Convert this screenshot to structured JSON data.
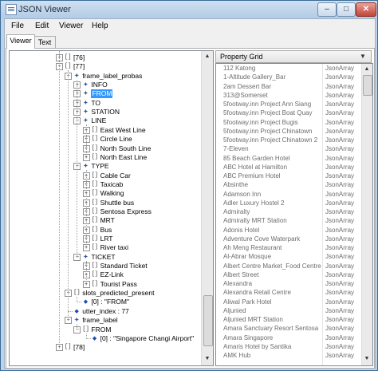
{
  "window": {
    "title": "JSON Viewer"
  },
  "menu": [
    "File",
    "Edit",
    "Viewer",
    "Help"
  ],
  "tabs": [
    {
      "label": "Viewer",
      "active": true
    },
    {
      "label": "Text",
      "active": false
    }
  ],
  "tree": [
    {
      "depth": 0,
      "icon": "array",
      "label": "[76]",
      "exp": "+"
    },
    {
      "depth": 0,
      "icon": "array",
      "label": "[77]",
      "exp": "-"
    },
    {
      "depth": 1,
      "icon": "object",
      "label": "frame_label_probas",
      "exp": "-"
    },
    {
      "depth": 2,
      "icon": "object",
      "label": "INFO",
      "exp": "+"
    },
    {
      "depth": 2,
      "icon": "object",
      "label": "FROM",
      "exp": "+",
      "selected": true
    },
    {
      "depth": 2,
      "icon": "object",
      "label": "TO",
      "exp": "+"
    },
    {
      "depth": 2,
      "icon": "object",
      "label": "STATION",
      "exp": "+"
    },
    {
      "depth": 2,
      "icon": "object",
      "label": "LINE",
      "exp": "-"
    },
    {
      "depth": 3,
      "icon": "array",
      "label": "East West Line",
      "exp": "+"
    },
    {
      "depth": 3,
      "icon": "array",
      "label": "Circle Line",
      "exp": "+"
    },
    {
      "depth": 3,
      "icon": "array",
      "label": "North South Line",
      "exp": "+"
    },
    {
      "depth": 3,
      "icon": "array",
      "label": "North East Line",
      "exp": "+"
    },
    {
      "depth": 2,
      "icon": "object",
      "label": "TYPE",
      "exp": "-"
    },
    {
      "depth": 3,
      "icon": "array",
      "label": "Cable Car",
      "exp": "+"
    },
    {
      "depth": 3,
      "icon": "array",
      "label": "Taxicab",
      "exp": "+"
    },
    {
      "depth": 3,
      "icon": "array",
      "label": "Walking",
      "exp": "+"
    },
    {
      "depth": 3,
      "icon": "array",
      "label": "Shuttle bus",
      "exp": "+"
    },
    {
      "depth": 3,
      "icon": "array",
      "label": "Sentosa Express",
      "exp": "+"
    },
    {
      "depth": 3,
      "icon": "array",
      "label": "MRT",
      "exp": "+"
    },
    {
      "depth": 3,
      "icon": "array",
      "label": "Bus",
      "exp": "+"
    },
    {
      "depth": 3,
      "icon": "array",
      "label": "LRT",
      "exp": "+"
    },
    {
      "depth": 3,
      "icon": "array",
      "label": "River taxi",
      "exp": "+"
    },
    {
      "depth": 2,
      "icon": "object",
      "label": "TICKET",
      "exp": "-"
    },
    {
      "depth": 3,
      "icon": "array",
      "label": "Standard Ticket",
      "exp": "+"
    },
    {
      "depth": 3,
      "icon": "array",
      "label": "EZ-Link",
      "exp": "+"
    },
    {
      "depth": 3,
      "icon": "array",
      "label": "Tourist Pass",
      "exp": "+"
    },
    {
      "depth": 1,
      "icon": "array",
      "label": "slots_predicted_present",
      "exp": "-"
    },
    {
      "depth": 2,
      "icon": "value",
      "label": "[0] : \"FROM\"",
      "exp": ""
    },
    {
      "depth": 1,
      "icon": "value",
      "label": "utter_index : 77",
      "exp": ""
    },
    {
      "depth": 1,
      "icon": "object",
      "label": "frame_label",
      "exp": "-"
    },
    {
      "depth": 2,
      "icon": "array",
      "label": "FROM",
      "exp": "-"
    },
    {
      "depth": 3,
      "icon": "value",
      "label": "[0] : \"Singapore Changi Airport\"",
      "exp": ""
    },
    {
      "depth": 0,
      "icon": "array",
      "label": "[78]",
      "exp": "+"
    }
  ],
  "property_grid": {
    "combo_label": "Property Grid",
    "rows": [
      [
        "112 Katong",
        "JsonArray"
      ],
      [
        "1-Altitude Gallery_Bar",
        "JsonArray"
      ],
      [
        "2am Dessert Bar",
        "JsonArray"
      ],
      [
        "313@Somerset",
        "JsonArray"
      ],
      [
        "5footway.inn Project Ann Siang",
        "JsonArray"
      ],
      [
        "5footway.inn Project Boat Quay",
        "JsonArray"
      ],
      [
        "5footway.inn Project Bugis",
        "JsonArray"
      ],
      [
        "5footway.inn Project Chinatown",
        "JsonArray"
      ],
      [
        "5footway.inn Project Chinatown 2",
        "JsonArray"
      ],
      [
        "7-Eleven",
        "JsonArray"
      ],
      [
        "85 Beach Garden Hotel",
        "JsonArray"
      ],
      [
        "ABC Hotel at Hamilton",
        "JsonArray"
      ],
      [
        "ABC Premium Hotel",
        "JsonArray"
      ],
      [
        "Absinthe",
        "JsonArray"
      ],
      [
        "Adamson Inn",
        "JsonArray"
      ],
      [
        "Adler Luxury Hostel 2",
        "JsonArray"
      ],
      [
        "Admiralty",
        "JsonArray"
      ],
      [
        "Admiralty MRT Station",
        "JsonArray"
      ],
      [
        "Adonis Hotel",
        "JsonArray"
      ],
      [
        "Adventure Cove Waterpark",
        "JsonArray"
      ],
      [
        "Ah Meng Restaurant",
        "JsonArray"
      ],
      [
        "Al-Abrar Mosque",
        "JsonArray"
      ],
      [
        "Albert Centre Market_Food Centre",
        "JsonArray"
      ],
      [
        "Albert Street",
        "JsonArray"
      ],
      [
        "Alexandra",
        "JsonArray"
      ],
      [
        "Alexandra Retail Centre",
        "JsonArray"
      ],
      [
        "Aliwal Park Hotel",
        "JsonArray"
      ],
      [
        "Aljunied",
        "JsonArray"
      ],
      [
        "Aljunied MRT Station",
        "JsonArray"
      ],
      [
        "Amara Sanctuary Resort Sentosa",
        "JsonArray"
      ],
      [
        "Amara Singapore",
        "JsonArray"
      ],
      [
        "Amaris Hotel by Santika",
        "JsonArray"
      ],
      [
        "AMK Hub",
        "JsonArray"
      ]
    ]
  }
}
